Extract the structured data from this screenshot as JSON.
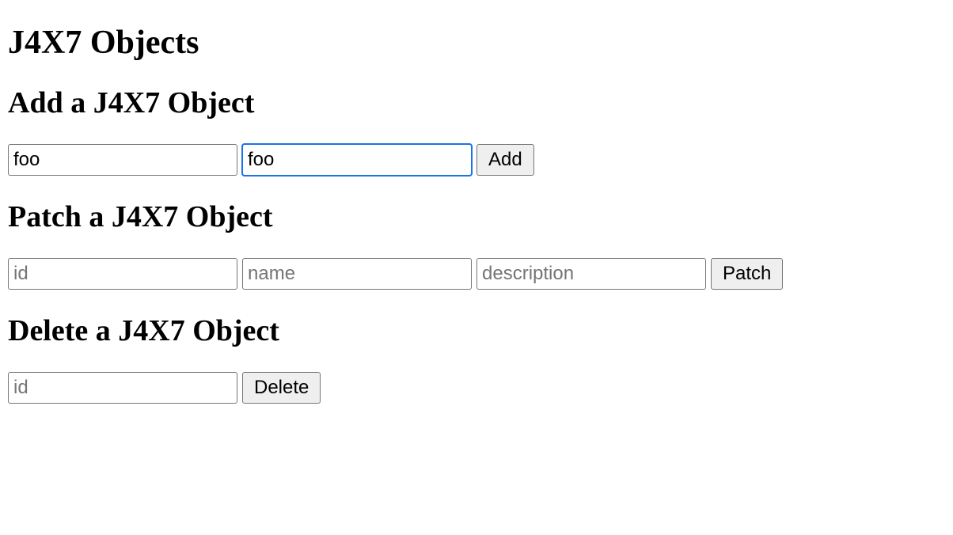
{
  "page": {
    "title": "J4X7 Objects"
  },
  "add": {
    "heading": "Add a J4X7 Object",
    "name_value": "foo",
    "desc_value": "foo",
    "button_label": "Add"
  },
  "patch": {
    "heading": "Patch a J4X7 Object",
    "id_placeholder": "id",
    "name_placeholder": "name",
    "desc_placeholder": "description",
    "button_label": "Patch"
  },
  "delete": {
    "heading": "Delete a J4X7 Object",
    "id_placeholder": "id",
    "button_label": "Delete"
  }
}
